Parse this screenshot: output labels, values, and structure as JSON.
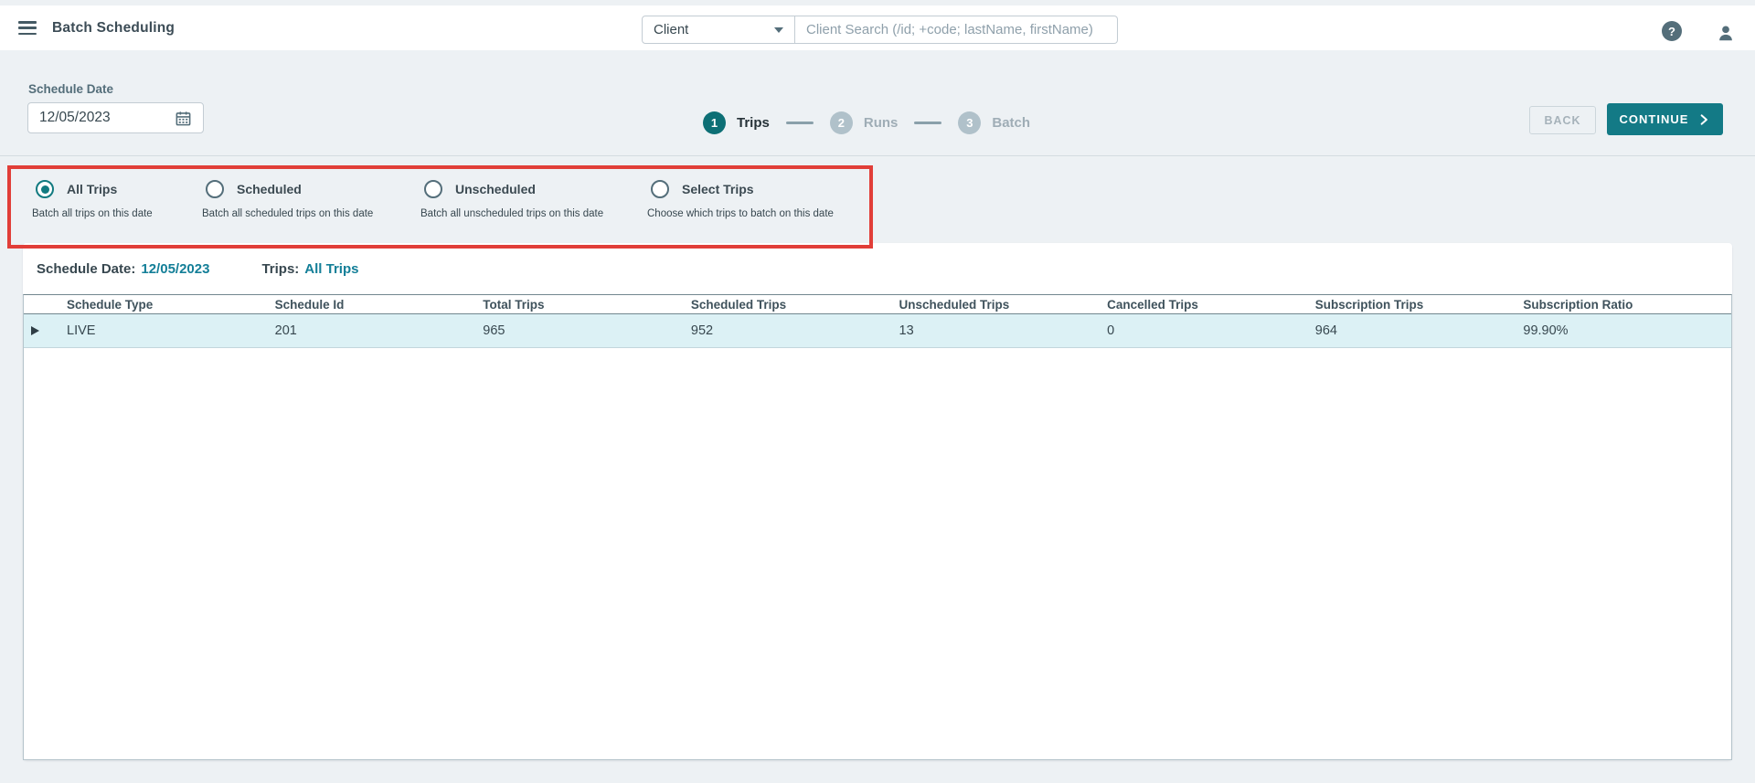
{
  "topbar": {
    "title": "Batch Scheduling",
    "search_category": "Client",
    "search_placeholder": "Client Search (/id; +code; lastName, firstName)",
    "help_glyph": "?"
  },
  "scheduler": {
    "date_label": "Schedule Date",
    "date_value": "12/05/2023",
    "back_label": "BACK",
    "continue_label": "CONTINUE"
  },
  "stepper": {
    "active_step": 1,
    "steps": [
      {
        "number": "1",
        "label": "Trips"
      },
      {
        "number": "2",
        "label": "Runs"
      },
      {
        "number": "3",
        "label": "Batch"
      }
    ]
  },
  "trip_filter": {
    "options": [
      {
        "label": "All Trips",
        "description": "Batch all trips on this date",
        "selected": true
      },
      {
        "label": "Scheduled",
        "description": "Batch all scheduled trips on this date",
        "selected": false
      },
      {
        "label": "Unscheduled",
        "description": "Batch all unscheduled trips on this date",
        "selected": false
      },
      {
        "label": "Select Trips",
        "description": "Choose which trips to batch on this date",
        "selected": false
      }
    ]
  },
  "summary": {
    "date_label": "Schedule Date:",
    "date_value": "12/05/2023",
    "trips_label": "Trips:",
    "trips_value": "All Trips"
  },
  "table": {
    "columns": [
      "Schedule Type",
      "Schedule Id",
      "Total Trips",
      "Scheduled Trips",
      "Unscheduled Trips",
      "Cancelled Trips",
      "Subscription Trips",
      "Subscription Ratio"
    ],
    "rows": [
      {
        "cells": [
          "LIVE",
          "201",
          "965",
          "952",
          "13",
          "0",
          "964",
          "99.90%"
        ]
      }
    ]
  },
  "colors": {
    "accent_teal": "#137A86",
    "step_active_teal": "#0D6F75",
    "link_teal": "#147F98",
    "row_highlight": "#DCF1F5",
    "highlight_border_red": "#E13E38",
    "page_background": "#EDF1F4"
  }
}
